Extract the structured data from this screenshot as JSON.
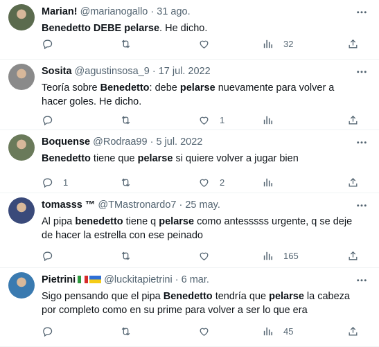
{
  "tweets": [
    {
      "name": "Marian!",
      "handle": "@marianogallo",
      "sep": "·",
      "date": "31 ago.",
      "text_segments": [
        {
          "t": "Benedetto",
          "b": true
        },
        {
          "t": " DEBE ",
          "b": true
        },
        {
          "t": "pelarse",
          "b": true
        },
        {
          "t": ". He dicho.",
          "b": false
        }
      ],
      "replies": "",
      "retweets": "",
      "likes": "",
      "views": "32",
      "avatar_color": "#5b6b4e"
    },
    {
      "name": "Sosita",
      "handle": "@agustinsosa_9",
      "sep": "·",
      "date": "17 jul. 2022",
      "text_segments": [
        {
          "t": "Teoría sobre ",
          "b": false
        },
        {
          "t": "Benedetto",
          "b": true
        },
        {
          "t": ": debe ",
          "b": false
        },
        {
          "t": "pelarse",
          "b": true
        },
        {
          "t": " nuevamente para volver a hacer goles. He dicho.",
          "b": false
        }
      ],
      "replies": "",
      "retweets": "",
      "likes": "1",
      "views": "",
      "avatar_color": "#8a8a8a"
    },
    {
      "name": "Boquense",
      "handle": "@Rodraa99",
      "sep": "·",
      "date": "5 jul. 2022",
      "text_segments": [
        {
          "t": "Benedetto",
          "b": true
        },
        {
          "t": " tiene que ",
          "b": false
        },
        {
          "t": "pelarse",
          "b": true
        },
        {
          "t": " si quiere volver a jugar bien",
          "b": false
        }
      ],
      "replies": "1",
      "retweets": "",
      "likes": "2",
      "views": "",
      "avatar_color": "#6a7a5a"
    },
    {
      "name": "tomasss ™",
      "handle": "@TMastronardo7",
      "sep": "·",
      "date": "25 may.",
      "text_segments": [
        {
          "t": "Al pipa ",
          "b": false
        },
        {
          "t": "benedetto",
          "b": true
        },
        {
          "t": " tiene q ",
          "b": false
        },
        {
          "t": "pelarse",
          "b": true
        },
        {
          "t": " como antesssss urgente, q se deje de hacer la estrella con ese peinado",
          "b": false
        }
      ],
      "replies": "",
      "retweets": "",
      "likes": "",
      "views": "165",
      "avatar_color": "#3a4a7a"
    },
    {
      "name": "Pietrini",
      "handle": "@luckitapietrini",
      "sep": "·",
      "date": "6 mar.",
      "text_segments": [
        {
          "t": "Sigo pensando que el pipa ",
          "b": false
        },
        {
          "t": "Benedetto",
          "b": true
        },
        {
          "t": " tendría que ",
          "b": false
        },
        {
          "t": "pelarse",
          "b": true
        },
        {
          "t": " la cabeza por completo como en su prime para volver a ser lo que era",
          "b": false
        }
      ],
      "replies": "",
      "retweets": "",
      "likes": "",
      "views": "45",
      "avatar_color": "#3a7ab0"
    }
  ],
  "colors": {
    "text": "#0f1419",
    "secondary": "#536471",
    "divider": "#eff3f4"
  },
  "icons": [
    "more-icon",
    "reply-icon",
    "retweet-icon",
    "like-icon",
    "views-icon",
    "share-icon"
  ]
}
